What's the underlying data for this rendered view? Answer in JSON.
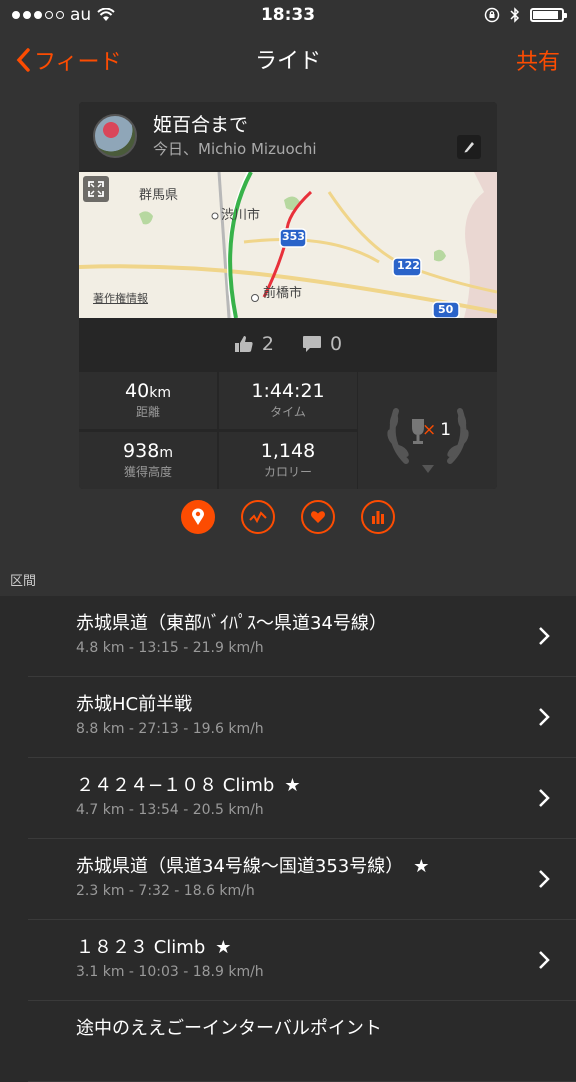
{
  "status_bar": {
    "carrier": "au",
    "time": "18:33",
    "battery_level": 0.9
  },
  "nav": {
    "back_label": "フィード",
    "title": "ライド",
    "share_label": "共有"
  },
  "activity": {
    "title": "姫百合まで",
    "subtitle": "今日、Michio Mizuochi",
    "map_labels": {
      "prefecture": "群馬県",
      "city1": "渋川市",
      "city2": "前橋市",
      "route_353": "353",
      "route_122": "122",
      "route_50": "50",
      "copyright": "著作権情報"
    },
    "likes": "2",
    "comments": "0"
  },
  "stats": {
    "distance_value": "40",
    "distance_unit": "km",
    "distance_label": "距離",
    "time_value": "1:44:21",
    "time_label": "タイム",
    "elevation_value": "938",
    "elevation_unit": "m",
    "elevation_label": "獲得高度",
    "calories_value": "1,148",
    "calories_label": "カロリー",
    "achievement_mark": "×",
    "achievement_count": "1"
  },
  "segments_header": "区間",
  "segments": [
    {
      "name": "赤城県道（東部ﾊﾞｲﾊﾟｽ〜県道34号線）",
      "star": "",
      "detail": "4.8 km - 13:15 - 21.9 km/h"
    },
    {
      "name": "赤城HC前半戦",
      "star": "",
      "detail": "8.8 km - 27:13 - 19.6 km/h"
    },
    {
      "name": "２４２４−１０８ Climb",
      "star": "★",
      "detail": "4.7 km - 13:54 - 20.5 km/h"
    },
    {
      "name": "赤城県道（県道34号線〜国道353号線）",
      "star": "★",
      "detail": "2.3 km - 7:32 - 18.6 km/h"
    },
    {
      "name": "１８２３ Climb",
      "star": "★",
      "detail": "3.1 km - 10:03 - 18.9 km/h"
    },
    {
      "name": "途中のええごーインターバルポイント",
      "star": "",
      "detail": ""
    }
  ],
  "colors": {
    "accent": "#fc4c02",
    "background": "#333333",
    "route": "#e8303a"
  }
}
